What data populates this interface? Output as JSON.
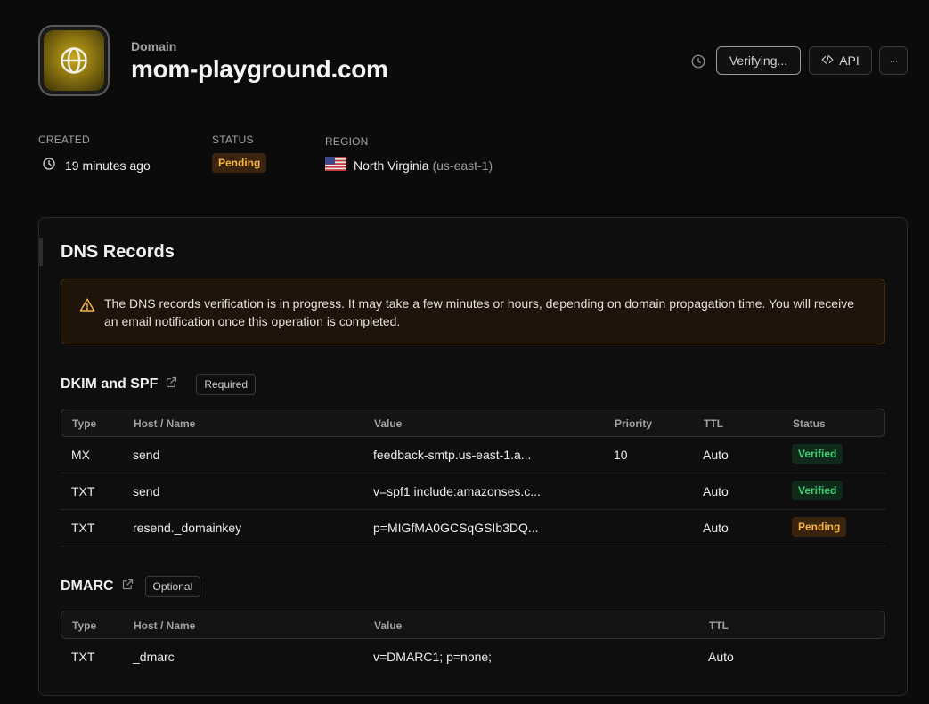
{
  "header": {
    "eyebrow": "Domain",
    "title": "mom-playground.com",
    "verify_label": "Verifying...",
    "api_label": "API",
    "more_label": "···"
  },
  "meta": {
    "created_label": "CREATED",
    "created_value": "19 minutes ago",
    "status_label": "STATUS",
    "status_value": "Pending",
    "region_label": "REGION",
    "region_name": "North Virginia",
    "region_code": "(us-east-1)"
  },
  "card": {
    "title": "DNS Records",
    "alert_text": "The DNS records verification is in progress. It may take a few minutes or hours, depending on domain propagation time. You will receive an email notification once this operation is completed."
  },
  "dkim": {
    "title": "DKIM and SPF",
    "chip": "Required",
    "headers": [
      "Type",
      "Host / Name",
      "Value",
      "Priority",
      "TTL",
      "Status"
    ],
    "rows": [
      {
        "type": "MX",
        "host": "send",
        "value": "feedback-smtp.us-east-1.a...",
        "priority": "10",
        "ttl": "Auto",
        "status": "Verified"
      },
      {
        "type": "TXT",
        "host": "send",
        "value": "v=spf1 include:amazonses.c...",
        "priority": "",
        "ttl": "Auto",
        "status": "Verified"
      },
      {
        "type": "TXT",
        "host": "resend._domainkey",
        "value": "p=MIGfMA0GCSqGSIb3DQ...",
        "priority": "",
        "ttl": "Auto",
        "status": "Pending"
      }
    ]
  },
  "dmarc": {
    "title": "DMARC",
    "chip": "Optional",
    "headers": [
      "Type",
      "Host / Name",
      "Value",
      "TTL"
    ],
    "rows": [
      {
        "type": "TXT",
        "host": "_dmarc",
        "value": "v=DMARC1; p=none;",
        "ttl": "Auto"
      }
    ]
  },
  "colors": {
    "pending": "#f5b53f",
    "verified": "#3fcf72",
    "background": "#0b0b0b"
  },
  "icons": [
    "globe-icon",
    "clock-icon",
    "code-icon",
    "more-icon",
    "warning-icon",
    "external-link-icon",
    "us-flag-icon"
  ]
}
